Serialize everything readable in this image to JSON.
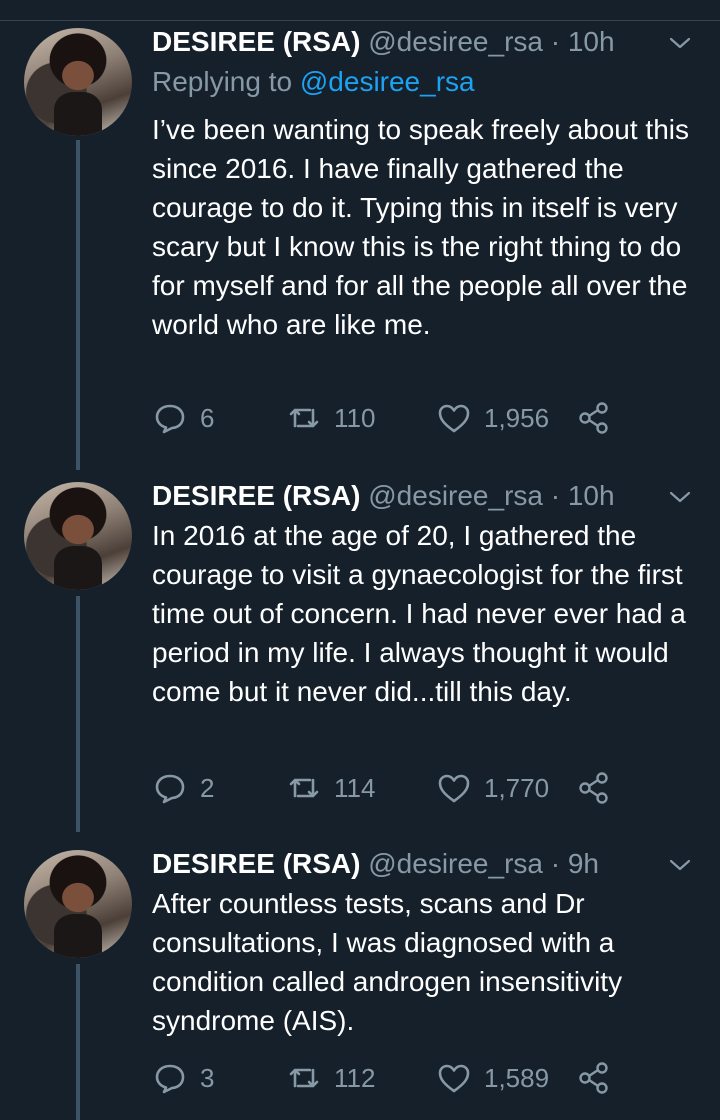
{
  "tweets": [
    {
      "name": "DESIREE (RSA)",
      "handle": "@desiree_rsa · 10h",
      "replying_prefix": "Replying to ",
      "replying_handle": "@desiree_rsa",
      "text": "I’ve been wanting to speak freely about this since  2016. I have finally gathered the courage to do it. Typing this in itself is very scary but I know this is the right thing to do for myself and for all the people all over the world who are like me.",
      "replies": "6",
      "retweets": "110",
      "likes": "1,956"
    },
    {
      "name": "DESIREE (RSA)",
      "handle": "@desiree_rsa · 10h",
      "text": "In 2016 at the age of 20, I gathered the courage to visit a gynaecologist for the first time out of concern. I had never ever had a period in my life. I always thought it would come but it never did...till this day.",
      "replies": "2",
      "retweets": "114",
      "likes": "1,770"
    },
    {
      "name": "DESIREE (RSA)",
      "handle": "@desiree_rsa · 9h",
      "text": "After countless tests, scans and Dr consultations, I was diagnosed with a condition called androgen insensitivity syndrome (AIS).",
      "replies": "3",
      "retweets": "112",
      "likes": "1,589"
    }
  ],
  "colors": {
    "background": "#15202b",
    "secondary_text": "#8899a6",
    "link": "#1da1f2",
    "thread_line": "#3d5466"
  },
  "icons": [
    "reply-icon",
    "retweet-icon",
    "like-icon",
    "share-icon",
    "chevron-down-icon"
  ]
}
